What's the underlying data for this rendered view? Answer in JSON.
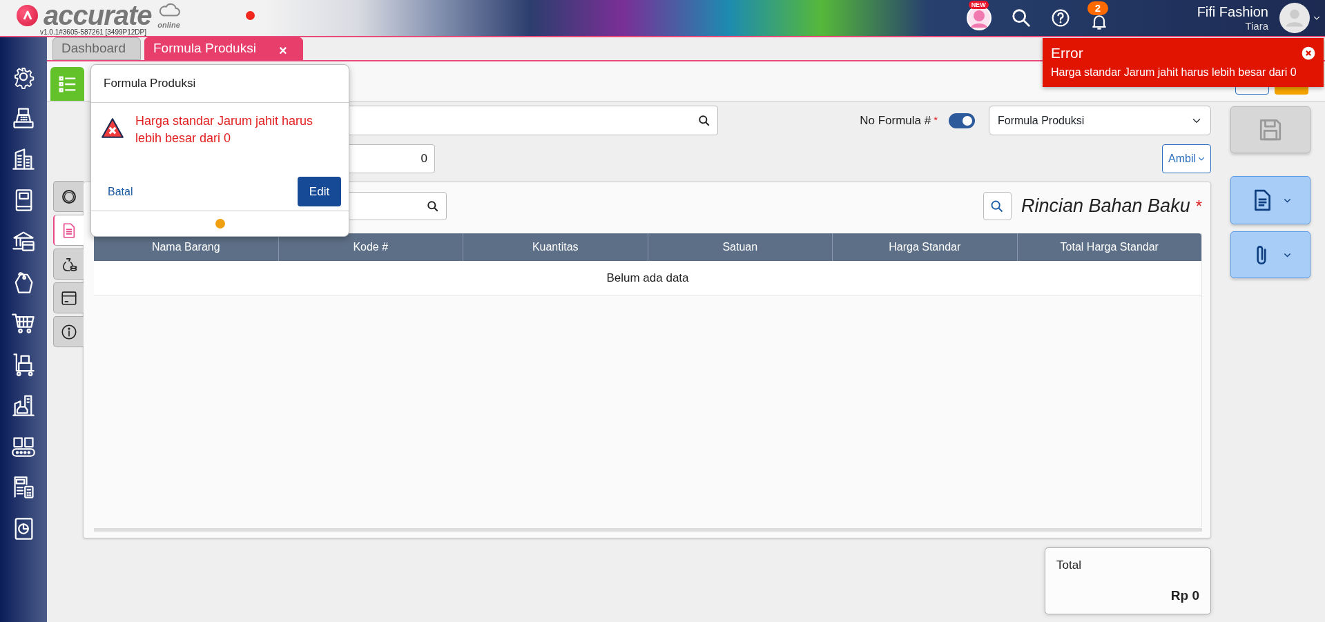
{
  "app": {
    "logo_text": "accurate",
    "logo_subtext": "online",
    "version": "v1.0.1#3605-587261 [3499P12DP]"
  },
  "header": {
    "new_badge": "NEW",
    "notification_count": "2",
    "company": "Fifi Fashion",
    "user": "Tiara"
  },
  "tabs": [
    {
      "label": "Dashboard",
      "selected": false
    },
    {
      "label": "Formula Produksi",
      "selected": true,
      "close": "×"
    }
  ],
  "form": {
    "formula_label": "No Formula #",
    "required_mark": "*",
    "auto_number": true,
    "formula_type": "Formula Produksi",
    "quantity": "0",
    "pick_button": "Ambil"
  },
  "side_tabs": [
    {
      "selected": false
    },
    {
      "selected": true
    },
    {
      "selected": false
    },
    {
      "selected": false
    },
    {
      "selected": false
    }
  ],
  "detail": {
    "title": "Rincian Bahan Baku",
    "required_mark": "*",
    "table": {
      "columns": [
        "Nama Barang",
        "Kode #",
        "Kuantitas",
        "Satuan",
        "Harga Standar",
        "Total Harga Standar"
      ],
      "empty_text": "Belum ada data"
    }
  },
  "total": {
    "label": "Total",
    "value": "Rp 0"
  },
  "actions": {
    "save_disabled": true
  },
  "popup": {
    "title": "Formula Produksi",
    "message": "Harga standar Jarum jahit harus lebih besar dari 0",
    "cancel": "Batal",
    "confirm": "Edit"
  },
  "toast": {
    "title": "Error",
    "message": "Harga standar Jarum jahit harus lebih besar dari 0"
  }
}
